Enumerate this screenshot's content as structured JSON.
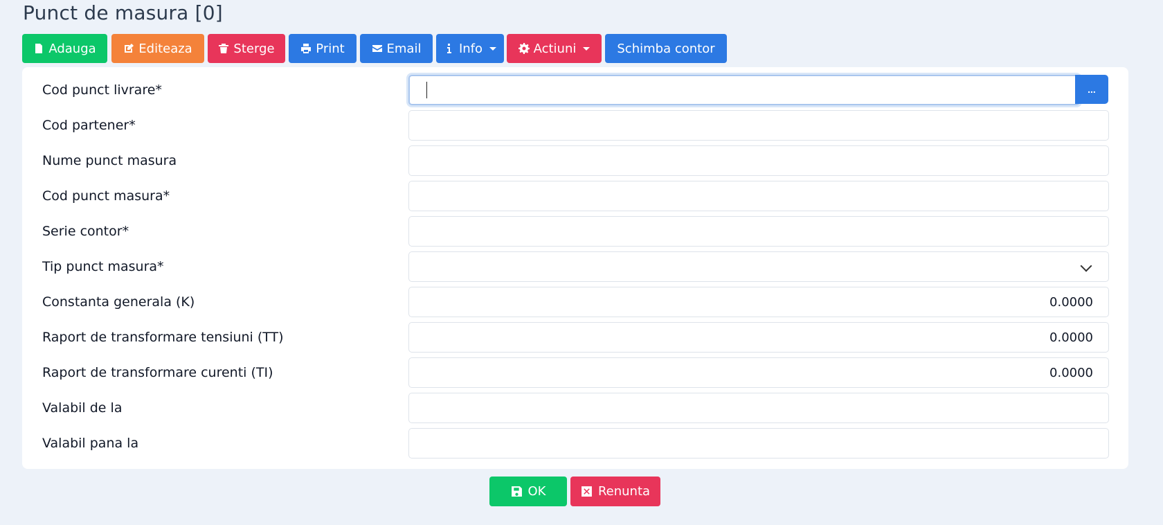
{
  "header": {
    "title": "Punct de masura [0]"
  },
  "toolbar": {
    "add": "Adauga",
    "edit": "Editeaza",
    "delete": "Sterge",
    "print": "Print",
    "email": "Email",
    "info": "Info",
    "actions": "Actiuni",
    "change_meter": "Schimba contor"
  },
  "form": {
    "cod_punct_livrare": {
      "label": "Cod punct livrare*",
      "value": "",
      "lookup": "..."
    },
    "cod_partener": {
      "label": "Cod partener*",
      "value": ""
    },
    "nume_punct_masura": {
      "label": "Nume punct masura",
      "value": ""
    },
    "cod_punct_masura": {
      "label": "Cod punct masura*",
      "value": ""
    },
    "serie_contor": {
      "label": "Serie contor*",
      "value": ""
    },
    "tip_punct_masura": {
      "label": "Tip punct masura*",
      "value": ""
    },
    "constanta_generala": {
      "label": "Constanta generala (K)",
      "value": "0.0000"
    },
    "raport_tt": {
      "label": "Raport de transformare tensiuni (TT)",
      "value": "0.0000"
    },
    "raport_ti": {
      "label": "Raport de transformare curenti (TI)",
      "value": "0.0000"
    },
    "valabil_de_la": {
      "label": "Valabil de la",
      "value": ""
    },
    "valabil_pana_la": {
      "label": "Valabil pana la",
      "value": ""
    }
  },
  "footer": {
    "ok": "OK",
    "cancel": "Renunta"
  },
  "colors": {
    "green": "#0cc769",
    "orange": "#f4823a",
    "red": "#e8355a",
    "blue": "#2c79e3",
    "background": "#edf2f9"
  }
}
